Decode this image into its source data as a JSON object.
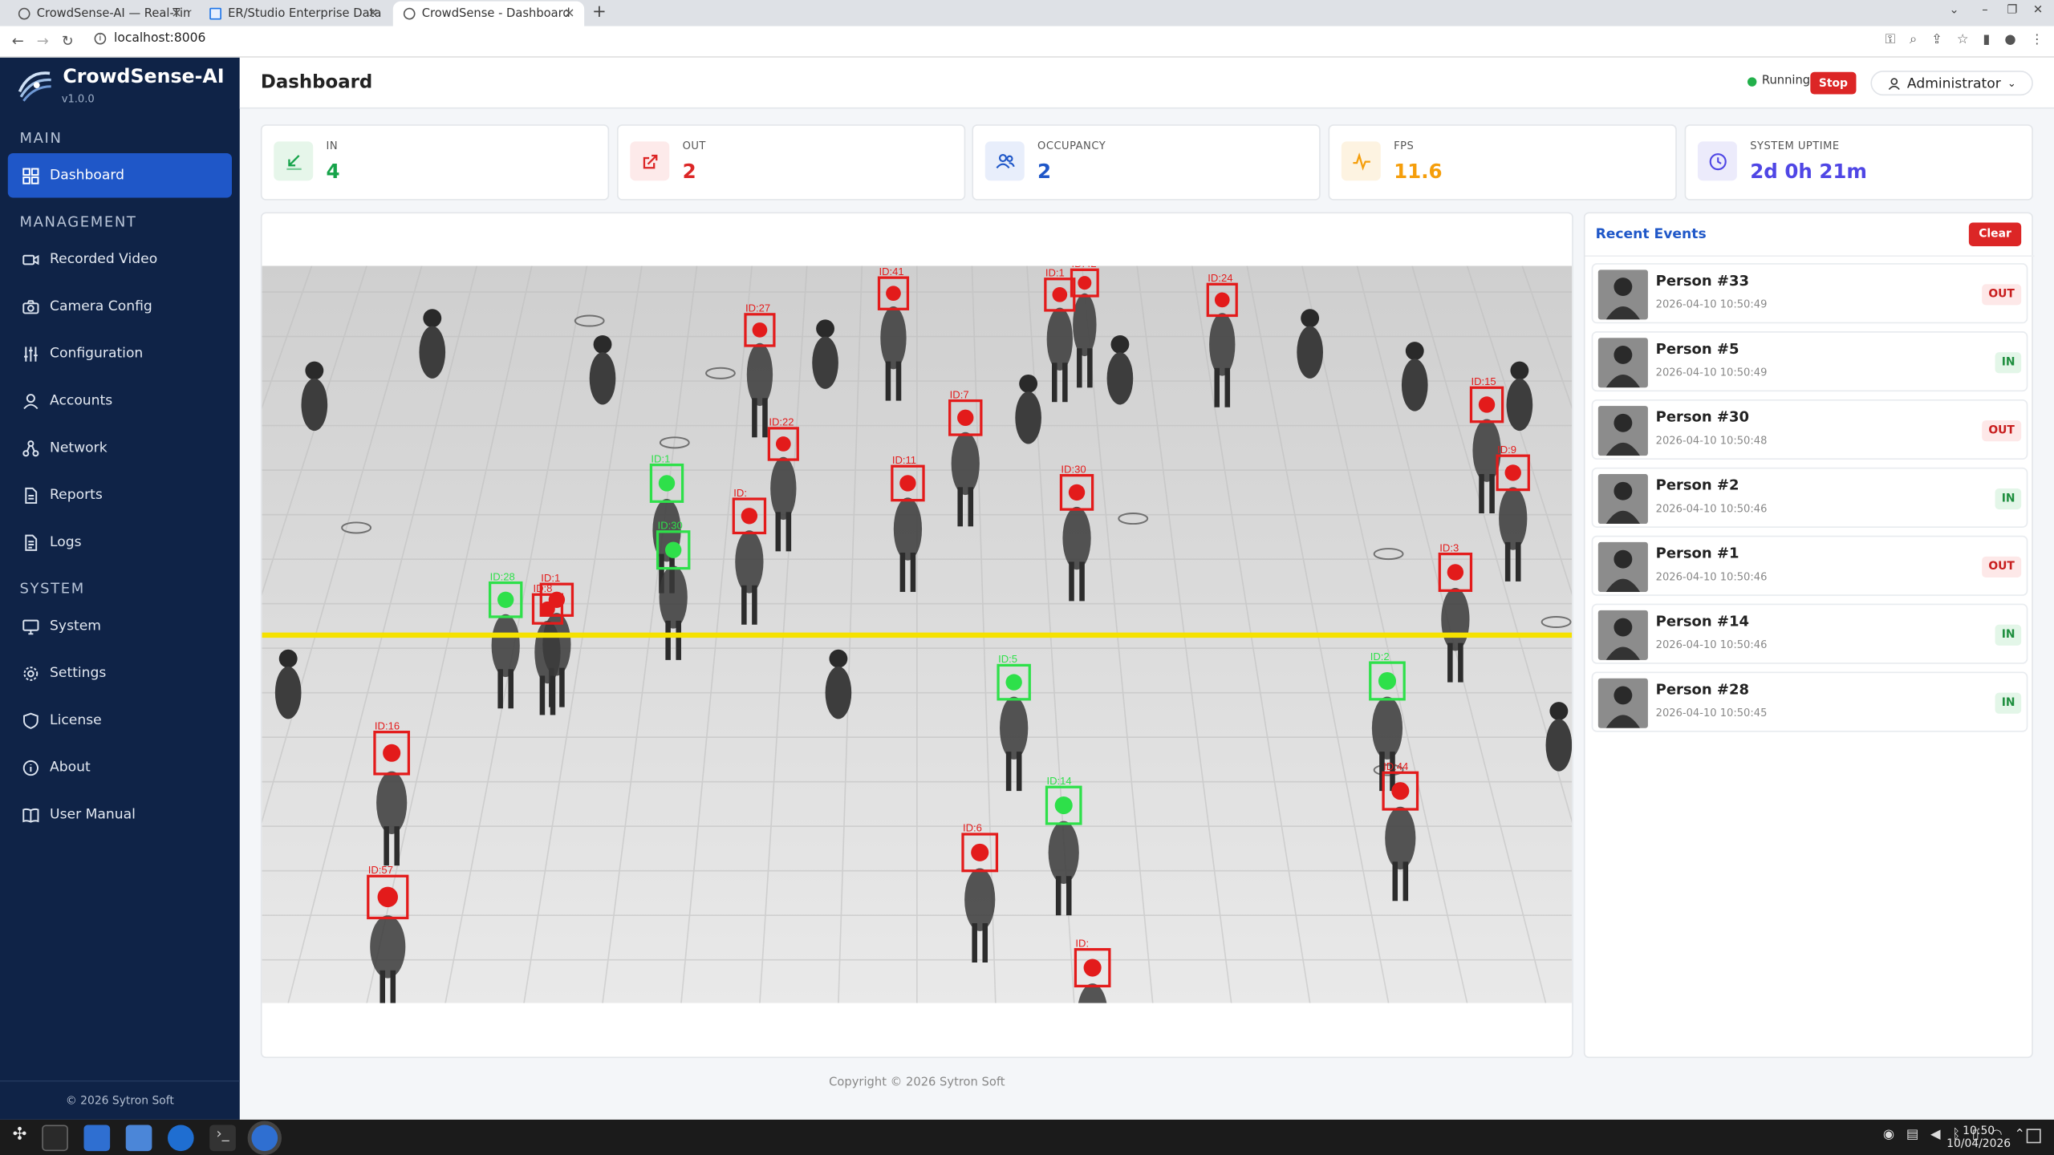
{
  "browser": {
    "tabs": [
      "CrowdSense-AI — Real-Tim",
      "ER/Studio Enterprise Data",
      "CrowdSense - Dashboard"
    ],
    "url": "localhost:8006"
  },
  "sidebar": {
    "brand": "CrowdSense-AI",
    "version": "v1.0.0",
    "sections": {
      "main": "MAIN",
      "management": "MANAGEMENT",
      "system": "SYSTEM"
    },
    "items": [
      {
        "label": "Dashboard",
        "icon": "dashboard-icon"
      },
      {
        "label": "Recorded Video",
        "icon": "video-icon"
      },
      {
        "label": "Camera Config",
        "icon": "camera-icon"
      },
      {
        "label": "Configuration",
        "icon": "sliders-icon"
      },
      {
        "label": "Accounts",
        "icon": "user-icon"
      },
      {
        "label": "Network",
        "icon": "network-icon"
      },
      {
        "label": "Reports",
        "icon": "report-icon"
      },
      {
        "label": "Logs",
        "icon": "log-icon"
      },
      {
        "label": "System",
        "icon": "monitor-icon"
      },
      {
        "label": "Settings",
        "icon": "gear-icon"
      },
      {
        "label": "License",
        "icon": "shield-icon"
      },
      {
        "label": "About",
        "icon": "info-icon"
      },
      {
        "label": "User Manual",
        "icon": "book-icon"
      }
    ],
    "footer": "© 2026 Sytron Soft"
  },
  "header": {
    "title": "Dashboard",
    "status": "Running",
    "stop_label": "Stop",
    "user": "Administrator"
  },
  "stats": [
    {
      "label": "IN",
      "value": "4",
      "color": "#16a34a"
    },
    {
      "label": "OUT",
      "value": "2",
      "color": "#dc2626"
    },
    {
      "label": "OCCUPANCY",
      "value": "2",
      "color": "#1f57c8"
    },
    {
      "label": "FPS",
      "value": "11.6",
      "color": "#f59e0b"
    },
    {
      "label": "SYSTEM UPTIME",
      "value": "2d 0h 21m",
      "color": "#4f46e5"
    }
  ],
  "detections": [
    {
      "id": "ID:41",
      "c": "r"
    },
    {
      "id": "ID:1",
      "c": "r"
    },
    {
      "id": "ID:42",
      "c": "r"
    },
    {
      "id": "ID:24",
      "c": "r"
    },
    {
      "id": "ID:27",
      "c": "r"
    },
    {
      "id": "ID:15",
      "c": "r"
    },
    {
      "id": "ID:7",
      "c": "r"
    },
    {
      "id": "ID:22",
      "c": "r"
    },
    {
      "id": "ID:9",
      "c": "r"
    },
    {
      "id": "ID:11",
      "c": "r"
    },
    {
      "id": "ID:30",
      "c": "r"
    },
    {
      "id": "ID:1",
      "c": "g"
    },
    {
      "id": "ID:",
      "c": "r"
    },
    {
      "id": "ID:30",
      "c": "g"
    },
    {
      "id": "ID:3",
      "c": "r"
    },
    {
      "id": "ID:28",
      "c": "g"
    },
    {
      "id": "ID:1",
      "c": "r"
    },
    {
      "id": "ID:8",
      "c": "r"
    },
    {
      "id": "ID:5",
      "c": "g"
    },
    {
      "id": "ID:2",
      "c": "g"
    },
    {
      "id": "ID:16",
      "c": "r"
    },
    {
      "id": "ID:14",
      "c": "g"
    },
    {
      "id": "ID:44",
      "c": "r"
    },
    {
      "id": "ID:6",
      "c": "r"
    },
    {
      "id": "ID:57",
      "c": "r"
    }
  ],
  "events": {
    "title": "Recent Events",
    "clear_label": "Clear",
    "items": [
      {
        "name": "Person #33",
        "time": "2026-04-10 10:50:49",
        "dir": "OUT"
      },
      {
        "name": "Person #5",
        "time": "2026-04-10 10:50:49",
        "dir": "IN"
      },
      {
        "name": "Person #30",
        "time": "2026-04-10 10:50:48",
        "dir": "OUT"
      },
      {
        "name": "Person #2",
        "time": "2026-04-10 10:50:46",
        "dir": "IN"
      },
      {
        "name": "Person #1",
        "time": "2026-04-10 10:50:46",
        "dir": "OUT"
      },
      {
        "name": "Person #14",
        "time": "2026-04-10 10:50:46",
        "dir": "IN"
      },
      {
        "name": "Person #28",
        "time": "2026-04-10 10:50:45",
        "dir": "IN"
      }
    ]
  },
  "footer": {
    "copyright": "Copyright © 2026 Sytron Soft"
  },
  "taskbar": {
    "time": "10:50",
    "date": "10/04/2026"
  }
}
